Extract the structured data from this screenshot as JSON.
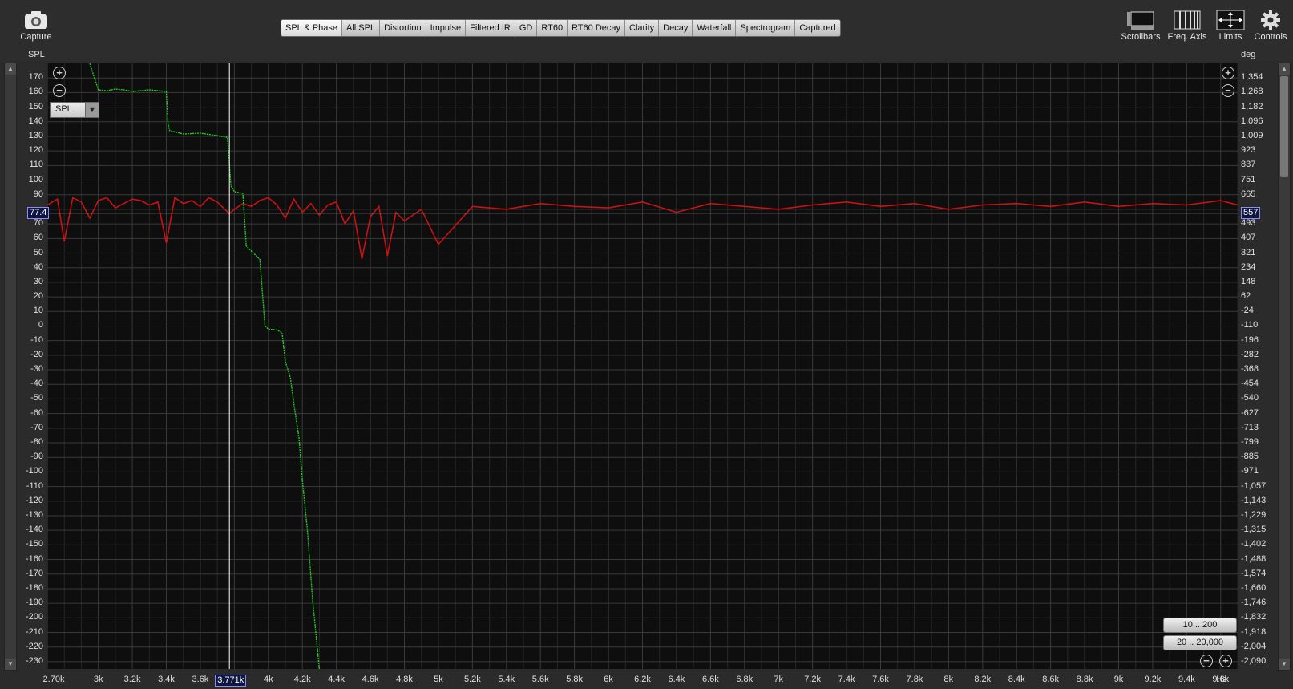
{
  "toolbar": {
    "capture_label": "Capture",
    "scrollbars_label": "Scrollbars",
    "freq_axis_label": "Freq. Axis",
    "limits_label": "Limits",
    "controls_label": "Controls"
  },
  "tabs": [
    "SPL & Phase",
    "All SPL",
    "Distortion",
    "Impulse",
    "Filtered IR",
    "GD",
    "RT60",
    "RT60 Decay",
    "Clarity",
    "Decay",
    "Waterfall",
    "Spectrogram",
    "Captured"
  ],
  "active_tab": "SPL & Phase",
  "axis_units": {
    "left": "SPL",
    "right": "deg",
    "x": "Hz"
  },
  "trace_select": "SPL",
  "cursor": {
    "freq": "3.771k",
    "spl": "77.4",
    "phase": "557"
  },
  "range_buttons": [
    "10 .. 200",
    "20 .. 20,000"
  ],
  "colors": {
    "spl_trace": "#cc1111",
    "phase_trace": "#22cc22",
    "plot_bg": "#0e0e0e",
    "grid": "#3a3a3a"
  },
  "chart_data": {
    "type": "line",
    "title": "",
    "xlabel": "Hz",
    "ylabel": "SPL",
    "y2label": "deg",
    "xlim": [
      2700,
      9700
    ],
    "ylim": [
      -235,
      180
    ],
    "y2lim": [
      -2112,
      1456
    ],
    "x_ticks": [
      2700,
      3000,
      3200,
      3400,
      3600,
      3800,
      4000,
      4200,
      4400,
      4600,
      4800,
      5000,
      5200,
      5400,
      5600,
      5800,
      6000,
      6200,
      6400,
      6600,
      6800,
      7000,
      7200,
      7400,
      7600,
      7800,
      8000,
      8200,
      8400,
      8600,
      8800,
      9000,
      9200,
      9400,
      9600
    ],
    "x_tick_labels": [
      "2.70k",
      "3k",
      "3.2k",
      "3.4k",
      "3.6k",
      "",
      "4k",
      "4.2k",
      "4.4k",
      "4.6k",
      "4.8k",
      "5k",
      "5.2k",
      "5.4k",
      "5.6k",
      "5.8k",
      "6k",
      "6.2k",
      "6.4k",
      "6.6k",
      "6.8k",
      "7k",
      "7.2k",
      "7.4k",
      "7.6k",
      "7.8k",
      "8k",
      "8.2k",
      "8.4k",
      "8.6k",
      "8.8k",
      "9k",
      "9.2k",
      "9.4k",
      "9.6k"
    ],
    "y_ticks": [
      170,
      160,
      150,
      140,
      130,
      120,
      110,
      100,
      90,
      80,
      70,
      60,
      50,
      40,
      30,
      20,
      10,
      0,
      -10,
      -20,
      -30,
      -40,
      -50,
      -60,
      -70,
      -80,
      -90,
      -100,
      -110,
      -120,
      -130,
      -140,
      -150,
      -160,
      -170,
      -180,
      -190,
      -200,
      -210,
      -220,
      -230
    ],
    "y_tick_labels": [
      "170",
      "160",
      "150",
      "140",
      "130",
      "120",
      "110",
      "100",
      "90",
      "",
      "70",
      "60",
      "50",
      "40",
      "30",
      "20",
      "10",
      "0",
      "-10",
      "-20",
      "-30",
      "-40",
      "-50",
      "-60",
      "-70",
      "-80",
      "-90",
      "-100",
      "-110",
      "-120",
      "-130",
      "-140",
      "-150",
      "-160",
      "-170",
      "-180",
      "-190",
      "-200",
      "-210",
      "-220",
      "-230"
    ],
    "y2_tick_labels": [
      "1,354",
      "1,268",
      "1,182",
      "1,096",
      "1,009",
      "923",
      "837",
      "751",
      "665",
      "",
      "493",
      "407",
      "321",
      "234",
      "148",
      "62",
      "-24",
      "-110",
      "-196",
      "-282",
      "-368",
      "-454",
      "-540",
      "-627",
      "-713",
      "-799",
      "-885",
      "-971",
      "-1,057",
      "-1,143",
      "-1,229",
      "-1,315",
      "-1,402",
      "-1,488",
      "-1,574",
      "-1,660",
      "-1,746",
      "-1,832",
      "-1,918",
      "-2,004",
      "-2,090"
    ],
    "grid": true,
    "series": [
      {
        "axis": "left",
        "x": [
          2700,
          2760,
          2800,
          2850,
          2900,
          2950,
          3000,
          3050,
          3100,
          3150,
          3200,
          3250,
          3300,
          3350,
          3400,
          3450,
          3500,
          3550,
          3600,
          3650,
          3700,
          3771,
          3800,
          3850,
          3900,
          3950,
          4000,
          4050,
          4100,
          4150,
          4200,
          4250,
          4300,
          4350,
          4400,
          4450,
          4500,
          4550,
          4600,
          4650,
          4700,
          4750,
          4800,
          4900,
          5000,
          5200,
          5400,
          5600,
          5800,
          6000,
          6200,
          6400,
          6600,
          6800,
          7000,
          7200,
          7400,
          7600,
          7800,
          8000,
          8200,
          8400,
          8600,
          8800,
          9000,
          9200,
          9400,
          9600,
          9700
        ],
        "y": [
          83,
          87,
          58,
          88,
          85,
          74,
          86,
          88,
          81,
          84,
          87,
          86,
          83,
          85,
          57,
          88,
          84,
          86,
          82,
          88,
          85,
          77,
          80,
          84,
          82,
          86,
          88,
          83,
          74,
          87,
          78,
          84,
          76,
          83,
          85,
          70,
          79,
          46,
          75,
          82,
          48,
          78,
          72,
          80,
          56,
          82,
          80,
          84,
          82,
          81,
          85,
          78,
          84,
          82,
          80,
          83,
          85,
          82,
          84,
          80,
          83,
          84,
          82,
          85,
          82,
          84,
          83,
          86,
          83
        ]
      },
      {
        "axis": "right",
        "x": [
          2950,
          3000,
          3050,
          3100,
          3150,
          3200,
          3300,
          3400,
          3410,
          3420,
          3500,
          3600,
          3700,
          3760,
          3780,
          3800,
          3850,
          3870,
          3900,
          3950,
          3980,
          4000,
          4050,
          4080,
          4100,
          4130,
          4150,
          4180,
          4200,
          4230,
          4260,
          4300
        ],
        "y": [
          1456,
          1300,
          1295,
          1305,
          1300,
          1290,
          1300,
          1290,
          1100,
          1060,
          1040,
          1045,
          1030,
          1020,
          735,
          700,
          690,
          380,
          350,
          300,
          -90,
          -110,
          -115,
          -130,
          -300,
          -400,
          -550,
          -750,
          -1000,
          -1300,
          -1700,
          -2112
        ]
      }
    ]
  }
}
